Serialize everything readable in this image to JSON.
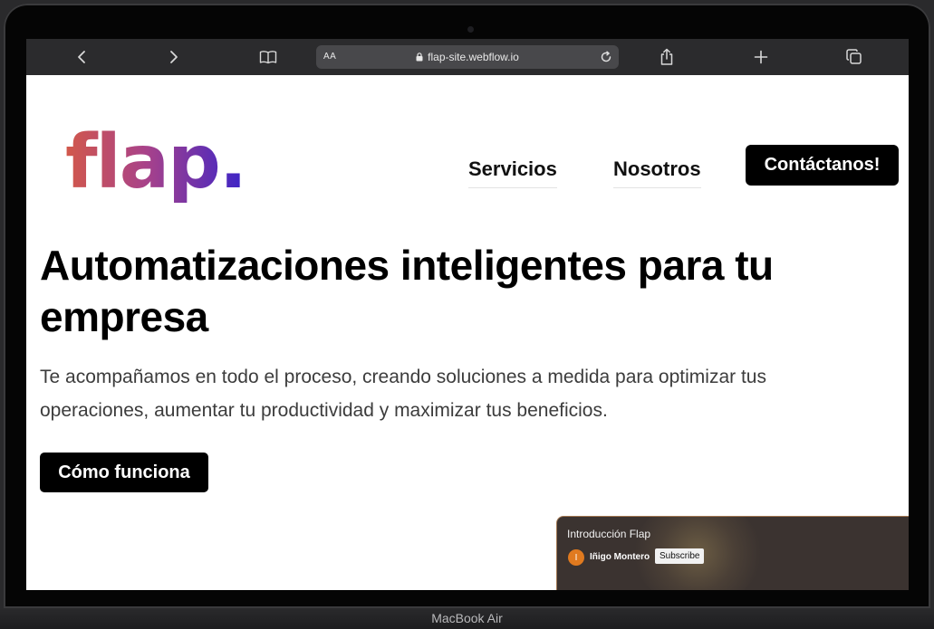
{
  "device": {
    "model_label": "MacBook Air"
  },
  "browser": {
    "text_size_label": "AA",
    "url": "flap-site.webflow.io"
  },
  "site": {
    "logo_text": "flap.",
    "nav": {
      "servicios": "Servicios",
      "nosotros": "Nosotros",
      "contact_cta": "Contáctanos!"
    },
    "hero": {
      "title": "Automatizaciones inteligentes para tu empresa",
      "subtitle": "Te acompañamos en todo el proceso, creando soluciones a medida para optimizar tus operaciones, aumentar tu productividad y maximizar tus beneficios.",
      "button_label": "Cómo funciona"
    },
    "video": {
      "title": "Introducción Flap",
      "avatar_initial": "I",
      "channel": "Iñigo Montero",
      "subscribe_label": "Subscribe"
    }
  },
  "colors": {
    "logo_gradient": [
      "#d2584a",
      "#a8428a",
      "#3b24c8"
    ],
    "button_bg": "#000000",
    "browser_bar": "#2b2b2d"
  },
  "icons": [
    "back-icon",
    "forward-icon",
    "bookmarks-icon",
    "lock-icon",
    "reload-icon",
    "share-icon",
    "new-tab-icon",
    "tabs-icon"
  ]
}
